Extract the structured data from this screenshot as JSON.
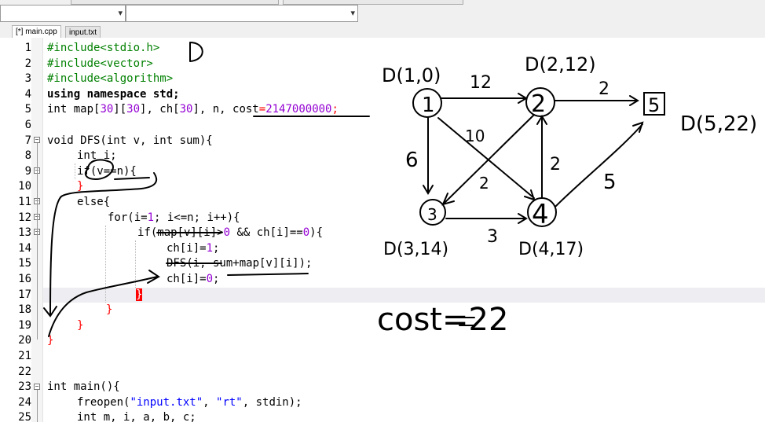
{
  "tabs": [
    {
      "label": "[*] main.cpp",
      "active": true
    },
    {
      "label": "input.txt",
      "active": false
    }
  ],
  "code": {
    "line_numbers": [
      "1",
      "2",
      "3",
      "4",
      "5",
      "6",
      "7",
      "8",
      "9",
      "10",
      "11",
      "12",
      "13",
      "14",
      "15",
      "16",
      "17",
      "18",
      "19",
      "20",
      "21",
      "22",
      "23",
      "24",
      "25"
    ],
    "l1": {
      "pp": "#include<stdio.h>"
    },
    "l2": {
      "pp": "#include<vector>"
    },
    "l3": {
      "pp": "#include<algorithm>"
    },
    "l4": {
      "a": "using namespace std;"
    },
    "l5": {
      "a": "int map[",
      "n1": "30",
      "b": "][",
      "n2": "30",
      "c": "], ch[",
      "n3": "30",
      "d": "], n, cost",
      "e": "=",
      "n4": "2147000000",
      "f": ";"
    },
    "l7": {
      "a": "void DFS(int v, int sum){"
    },
    "l8": {
      "a": "int i;"
    },
    "l9": {
      "a": "if(v==n){"
    },
    "l10": {
      "a": "}"
    },
    "l11": {
      "a": "else{"
    },
    "l12": {
      "a": "for(i=",
      "n1": "1",
      "b": "; i<=n; i++){"
    },
    "l13": {
      "a": "if(map[v][i]>",
      "n1": "0",
      "b": " && ch[i]==",
      "n2": "0",
      "c": "){"
    },
    "l14": {
      "a": "ch[i]=",
      "n1": "1",
      "b": ";"
    },
    "l15": {
      "a": "DFS(i, sum+map[v][i]);"
    },
    "l16": {
      "a": "ch[i]=",
      "n1": "0",
      "b": ";"
    },
    "l17": {
      "a": "}"
    },
    "l18": {
      "a": "}"
    },
    "l19": {
      "a": "}"
    },
    "l20": {
      "a": "}"
    },
    "l23": {
      "a": "int main(){"
    },
    "l24": {
      "a": "freopen(",
      "s1": "\"input.txt\"",
      "b": ", ",
      "s2": "\"rt\"",
      "c": ", stdin);"
    },
    "l25": {
      "a": "int m, i, a, b, c;"
    }
  },
  "annotations": {
    "letter_d": "D",
    "node_labels": [
      "1",
      "2",
      "3",
      "4",
      "5"
    ],
    "edge_weights": [
      "12",
      "2",
      "10",
      "6",
      "2",
      "2",
      "3",
      "5"
    ],
    "dist_labels": [
      "D(1,0)",
      "D(2,12)",
      "D(5,22)",
      "D(3,14)",
      "D(4,17)"
    ],
    "result": "cost=22"
  },
  "colors": {
    "keyword": "#000000",
    "preprocessor": "#008000",
    "number": "#9400d3",
    "string": "#0000ff",
    "operator": "#ff0000",
    "current_line": "#eeeef2"
  }
}
